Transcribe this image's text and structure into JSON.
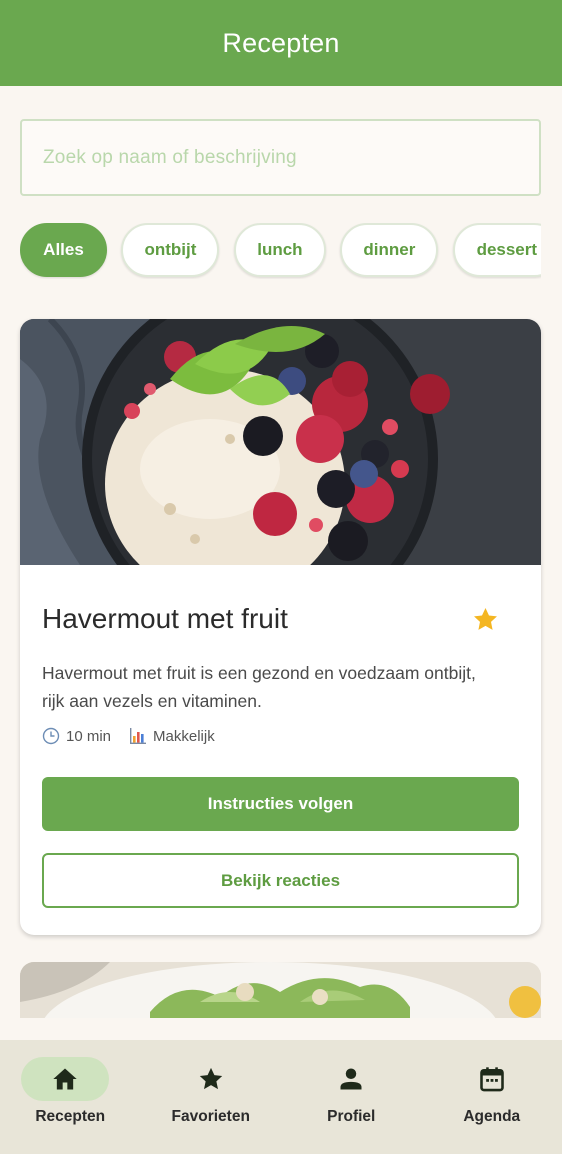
{
  "appbar": {
    "title": "Recepten"
  },
  "search": {
    "placeholder": "Zoek op naam of beschrijving"
  },
  "filters": {
    "active": "Alles",
    "items": [
      "Alles",
      "ontbijt",
      "lunch",
      "dinner",
      "dessert"
    ]
  },
  "recipes": [
    {
      "title": "Havermout met fruit",
      "favorite": true,
      "description": "Havermout met fruit is een gezond en voedzaam ontbijt, rijk aan vezels en vitaminen.",
      "time": "10 min",
      "difficulty": "Makkelijk",
      "primary_action": "Instructies volgen",
      "secondary_action": "Bekijk reacties"
    }
  ],
  "bottom_nav": {
    "active": "Recepten",
    "items": [
      {
        "label": "Recepten",
        "icon": "home-icon"
      },
      {
        "label": "Favorieten",
        "icon": "star-icon"
      },
      {
        "label": "Profiel",
        "icon": "person-icon"
      },
      {
        "label": "Agenda",
        "icon": "calendar-icon"
      }
    ]
  },
  "colors": {
    "primary": "#6aa84f",
    "background": "#faf6f1",
    "star": "#f4b622",
    "nav_background": "#e8e5d8",
    "nav_active_pill": "#cfe3bf"
  }
}
